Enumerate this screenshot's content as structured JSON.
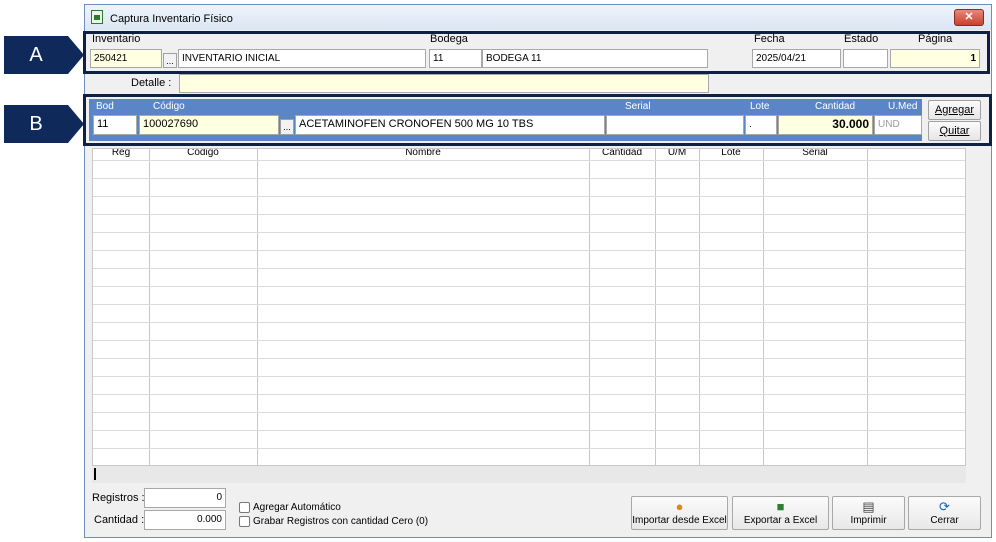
{
  "window": {
    "title": "Captura Inventario Físico",
    "close_label": "✕"
  },
  "callouts": {
    "a": "A",
    "b": "B"
  },
  "header": {
    "inventario_label": "Inventario",
    "inventario_code": "250421",
    "inventario_name": "INVENTARIO INICIAL",
    "bodega_label": "Bodega",
    "bodega_code": "11",
    "bodega_name": "BODEGA 11",
    "fecha_label": "Fecha",
    "fecha_value": "2025/04/21",
    "estado_label": "Estado",
    "estado_value": "",
    "pagina_label": "Página",
    "pagina_value": "1",
    "detalle_label": "Detalle :",
    "detalle_value": "",
    "ellipsis": "..."
  },
  "entry": {
    "bod_label": "Bod",
    "bod_value": "11",
    "codigo_label": "Código",
    "codigo_value": "100027690",
    "nombre_value": "ACETAMINOFEN CRONOFEN 500 MG 10 TBS",
    "serial_label": "Serial",
    "serial_value": "",
    "lote_label": "Lote",
    "lote_value": ".",
    "cantidad_label": "Cantidad",
    "cantidad_value": "30.000",
    "umed_label": "U.Med",
    "umed_value": "UND",
    "agregar_label": "Agregar",
    "quitar_label": "Quitar",
    "ellipsis": "..."
  },
  "grid": {
    "columns": [
      "Reg",
      "Código",
      "Nombre",
      "Cantidad",
      "U/M",
      "Lote",
      "Serial"
    ],
    "rows": []
  },
  "footer": {
    "registros_label": "Registros :",
    "registros_value": "0",
    "cantidad_label": "Cantidad :",
    "cantidad_value": "0.000",
    "agregar_automatico_label": "Agregar Automático",
    "grabar_cero_label": "Grabar Registros con cantidad Cero (0)",
    "importar_label": "Importar desde Excel",
    "exportar_label": "Exportar a Excel",
    "imprimir_label": "Imprimir",
    "cerrar_label": "Cerrar"
  },
  "icons": {
    "app": "spreadsheet-icon",
    "importar": "people-import-icon",
    "exportar": "briefcase-export-icon",
    "imprimir": "printer-icon",
    "cerrar": "exit-door-icon"
  },
  "colors": {
    "accent_blue": "#5a86c8",
    "callout": "#0f2a5a",
    "field_yellow": "#ffffe1",
    "close_red": "#c8412c"
  }
}
